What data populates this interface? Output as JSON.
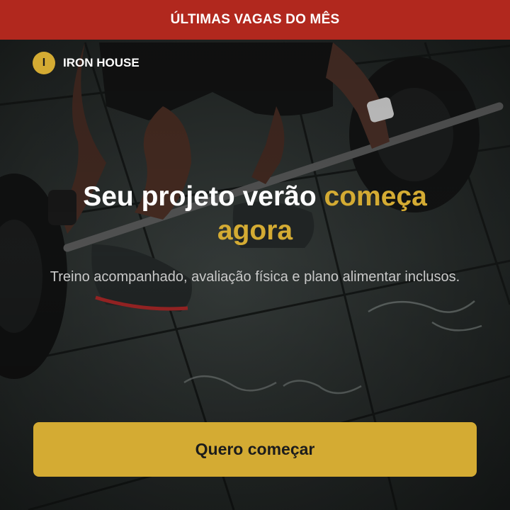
{
  "banner": {
    "text": "ÚLTIMAS VAGAS DO MÊS"
  },
  "brand": {
    "initial": "I",
    "name": "IRON HOUSE"
  },
  "hero": {
    "headline_main": "Seu projeto verão ",
    "headline_highlight": "começa agora",
    "subtitle": "Treino acompanhado, avaliação física e plano alimentar inclusos."
  },
  "cta": {
    "label": "Quero começar"
  },
  "colors": {
    "banner": "#b1281e",
    "accent": "#d4ab33",
    "text": "#ffffff",
    "subtitle": "#c9c9c9"
  },
  "background": {
    "subject": "athlete lifting a barbell on a gym floor",
    "icon": "barbell-photo"
  }
}
